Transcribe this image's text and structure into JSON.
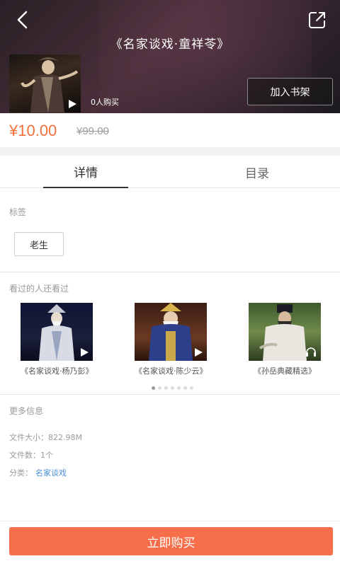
{
  "header": {
    "title": "《名家谈戏·童祥苓》",
    "buyers": "0人购买",
    "shelf_button": "加入书架"
  },
  "price": {
    "current": "¥10.00",
    "original": "¥99.00"
  },
  "tabs": [
    {
      "label": "详情",
      "active": true
    },
    {
      "label": "目录",
      "active": false
    }
  ],
  "tags_section": {
    "label": "标签",
    "tags": [
      "老生"
    ]
  },
  "recommend_section": {
    "label": "看过的人还看过",
    "items": [
      {
        "title": "《名家谈戏·杨乃彭》",
        "icon": "play-icon"
      },
      {
        "title": "《名家谈戏·陈少云》",
        "icon": "play-icon"
      },
      {
        "title": "《孙岳典藏精选》",
        "icon": "headphones-icon"
      }
    ],
    "page_count": 7,
    "current_page": 1
  },
  "more_info": {
    "label": "更多信息",
    "file_size": "文件大小：822.98M",
    "file_count": "文件数：1个",
    "category_label": "分类：",
    "category_value": "名家谈戏"
  },
  "footer": {
    "buy_button": "立即购买"
  },
  "colors": {
    "accent": "#f2703a",
    "buy_button": "#f66f4a",
    "link": "#4a8fd6"
  }
}
